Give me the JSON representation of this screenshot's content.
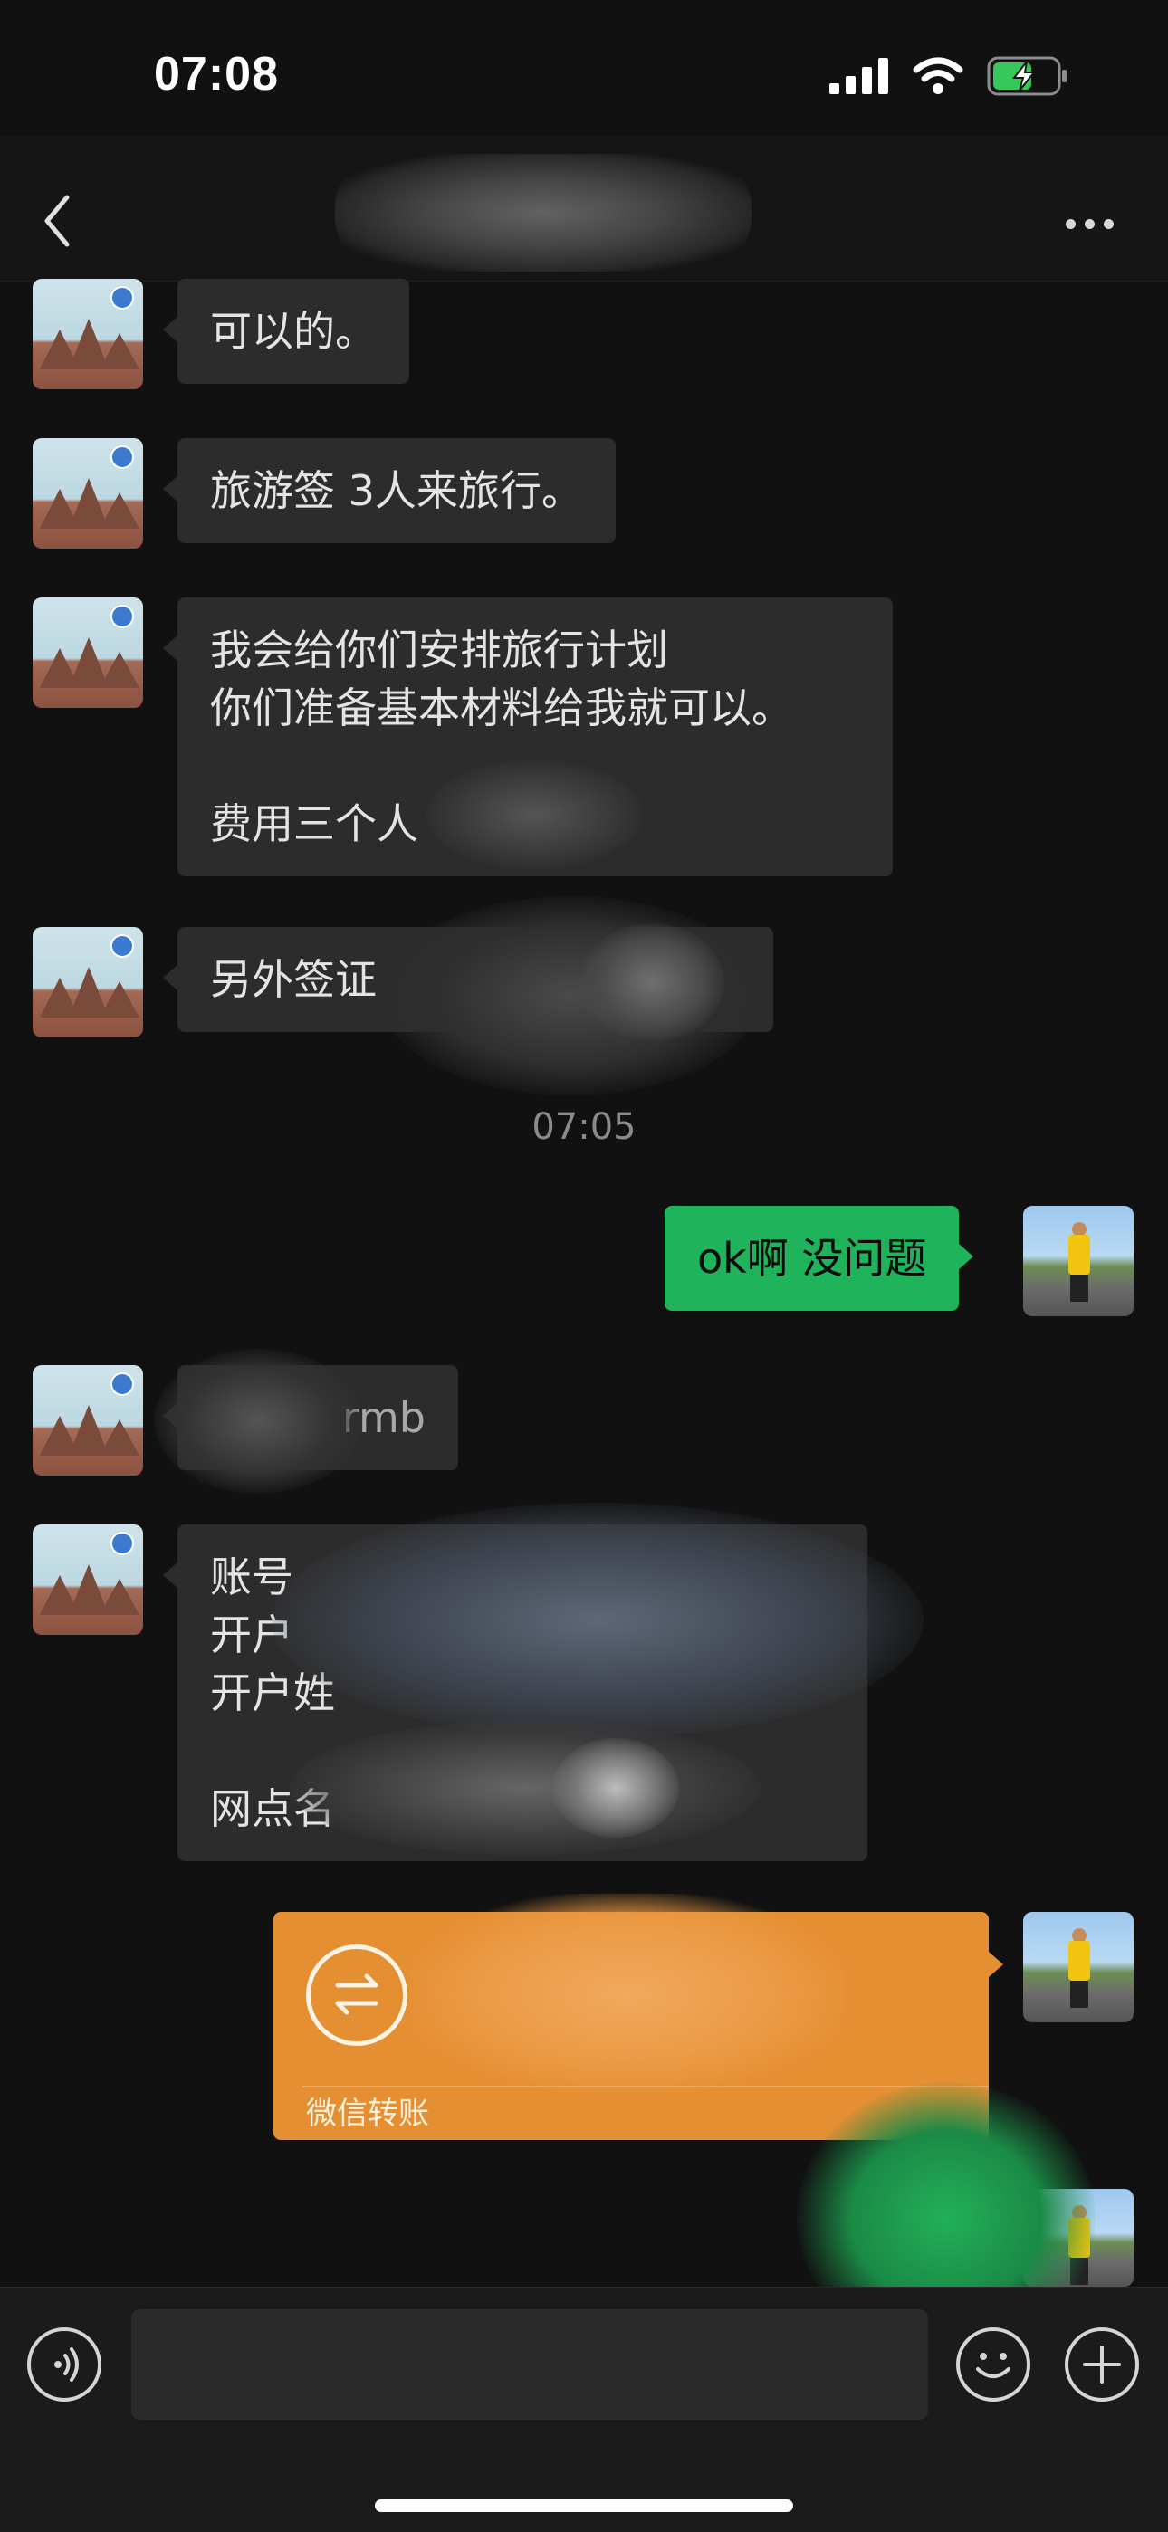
{
  "status_bar": {
    "time": "07:08",
    "battery_charging": true
  },
  "nav": {
    "title": "",
    "back_icon": "chevron-left-icon",
    "more_icon": "ellipsis-icon"
  },
  "messages": [
    {
      "side": "left",
      "text": "可以的。"
    },
    {
      "side": "left",
      "text": "旅游签 3人来旅行。"
    },
    {
      "side": "left",
      "text": "我会给你们安排旅行计划\n你们准备基本材料给我就可以。\n\n费用三个人"
    },
    {
      "side": "left",
      "text": "另外签证"
    },
    {
      "side": "right",
      "text": "ok啊 没问题"
    },
    {
      "side": "left",
      "text": "rmb"
    },
    {
      "side": "left",
      "text": "账号\n开户\n开户姓\n\n网点名"
    }
  ],
  "timestamp": "07:05",
  "transfer": {
    "label": "微信转账",
    "icon": "transfer-arrows-icon"
  },
  "input_bar": {
    "voice_icon": "voice-icon",
    "emoji_icon": "emoji-icon",
    "plus_icon": "plus-icon"
  },
  "colors": {
    "background": "#111111",
    "bubble_left": "#2c2c2c",
    "bubble_right": "#1fb35c",
    "transfer": "#e58f33"
  }
}
